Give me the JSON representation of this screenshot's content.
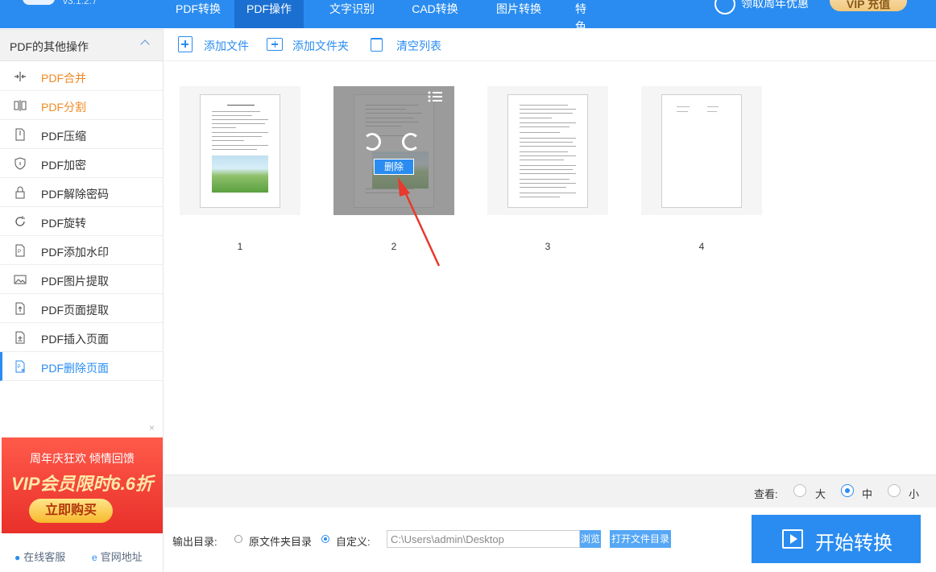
{
  "app": {
    "version": "v3.1.2.7"
  },
  "nav": {
    "tabs": [
      {
        "label": "PDF转换"
      },
      {
        "label": "PDF操作"
      },
      {
        "label": "文字识别"
      },
      {
        "label": "CAD转换"
      },
      {
        "label": "图片转换"
      },
      {
        "label": "特色转换"
      }
    ],
    "active_tab": "PDF操作",
    "promo": "领取周年优惠",
    "vip_label": "VIP 充值"
  },
  "sidebar": {
    "title": "PDF的其他操作",
    "items": [
      {
        "label": "PDF合并",
        "icon": "merge-icon"
      },
      {
        "label": "PDF分割",
        "icon": "split-icon"
      },
      {
        "label": "PDF压缩",
        "icon": "compress-icon"
      },
      {
        "label": "PDF加密",
        "icon": "shield-icon"
      },
      {
        "label": "PDF解除密码",
        "icon": "unlock-icon"
      },
      {
        "label": "PDF旋转",
        "icon": "rotate-icon"
      },
      {
        "label": "PDF添加水印",
        "icon": "watermark-icon"
      },
      {
        "label": "PDF图片提取",
        "icon": "image-icon"
      },
      {
        "label": "PDF页面提取",
        "icon": "page-extract-icon"
      },
      {
        "label": "PDF插入页面",
        "icon": "page-insert-icon"
      },
      {
        "label": "PDF删除页面",
        "icon": "page-delete-icon"
      }
    ],
    "active_item": "PDF删除页面",
    "ad": {
      "line1": "周年庆狂欢 倾情回馈",
      "line2": "VIP会员限时6.6折",
      "button": "立即购买",
      "close": "×"
    },
    "footer": {
      "support": "在线客服",
      "website": "官网地址"
    }
  },
  "toolbar": {
    "add_file": "添加文件",
    "add_folder": "添加文件夹",
    "clear_list": "清空列表"
  },
  "pages": [
    {
      "number": "1"
    },
    {
      "number": "2",
      "overlay": true,
      "delete_label": "删除"
    },
    {
      "number": "3"
    },
    {
      "number": "4"
    }
  ],
  "view": {
    "label": "查看:",
    "options": [
      "大",
      "中",
      "小"
    ],
    "selected": "中"
  },
  "output": {
    "label": "输出目录:",
    "option_source": "原文件夹目录",
    "option_custom": "自定义:",
    "selected": "自定义:",
    "path": "C:\\Users\\admin\\Desktop",
    "browse": "浏览",
    "open_folder": "打开文件目录"
  },
  "start_button": "开始转换",
  "colors": {
    "primary": "#2a8cf0",
    "orange": "#f08a24",
    "annotation_arrow": "#e8392e"
  }
}
